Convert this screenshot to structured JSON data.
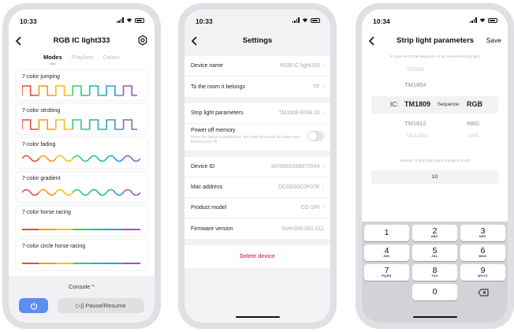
{
  "phone1": {
    "time": "10:33",
    "title": "RGB IC light333",
    "tabs": [
      "Modes",
      "Playlists",
      "Colors"
    ],
    "modes": [
      {
        "label": "7-color jumping",
        "wave": "square"
      },
      {
        "label": "7-color strobing",
        "wave": "square"
      },
      {
        "label": "7-color fading",
        "wave": "sine"
      },
      {
        "label": "7-color gradient",
        "wave": "sine"
      },
      {
        "label": "7-color horse racing",
        "wave": "line"
      },
      {
        "label": "7-color circle horse racing",
        "wave": "line"
      }
    ],
    "console_label": "Console ^",
    "pause_label": "▷|| Pause/Resume",
    "icons": {
      "back": "back-chevron-icon",
      "settings": "settings-gear-icon",
      "power": "power-icon"
    },
    "colors": {
      "accent": "#5b8ef0",
      "rainbow": [
        "#e74c3c",
        "#f39c12",
        "#f1c40f",
        "#2ecc71",
        "#1abc9c",
        "#3498db",
        "#9b59b6"
      ]
    }
  },
  "phone2": {
    "time": "10:33",
    "title": "Settings",
    "group1": [
      {
        "key": "Device name",
        "value": "RGB IC light333"
      },
      {
        "key": "To the room it belongs",
        "value": "TF"
      }
    ],
    "group2": {
      "strip": {
        "key": "Strip light parameters",
        "value": "TM1809 RGB 10"
      },
      "memory": {
        "key": "Power off memory",
        "sub": "When the device is powered on, the relay will remain the state it was before power off",
        "on": false
      }
    },
    "group3": [
      {
        "key": "Device ID",
        "value": "3476951658972544"
      },
      {
        "key": "Mac address",
        "value": "DC0D30C0F07E"
      },
      {
        "key": "Product model",
        "value": "CG-SPI"
      },
      {
        "key": "Firmware version",
        "value": "SVer000.001.011"
      }
    ],
    "delete_label": "Delete device",
    "colors": {
      "danger": "#e0455a"
    }
  },
  "phone3": {
    "time": "10:34",
    "title": "Strip light parameters",
    "save_label": "Save",
    "hint": "IC type and RGB sequence of its connected strip light",
    "picker": {
      "ic_above2": "TM1803",
      "ic_above1": "TM1804",
      "ic_label": "IC:",
      "ic_selected": "TM1809",
      "sequence_label": "Sequence:",
      "sequence_selected": "RGB",
      "ic_below1": "TM1812",
      "seq_below1": "RBG",
      "ic_below2": "UCS1903",
      "seq_below2": "GRB"
    },
    "pixels_hint": "Number of strip light pixels (range:8-1020)",
    "pixels_value": "10",
    "keys": [
      [
        {
          "d": "1",
          "l": ""
        },
        {
          "d": "2",
          "l": "ABC"
        },
        {
          "d": "3",
          "l": "DEF"
        }
      ],
      [
        {
          "d": "4",
          "l": "GHI"
        },
        {
          "d": "5",
          "l": "JKL"
        },
        {
          "d": "6",
          "l": "MNO"
        }
      ],
      [
        {
          "d": "7",
          "l": "PQRS"
        },
        {
          "d": "8",
          "l": "TUV"
        },
        {
          "d": "9",
          "l": "WXYZ"
        }
      ]
    ],
    "zero": "0",
    "icons": {
      "back": "back-chevron-icon",
      "backspace": "backspace-icon"
    }
  }
}
